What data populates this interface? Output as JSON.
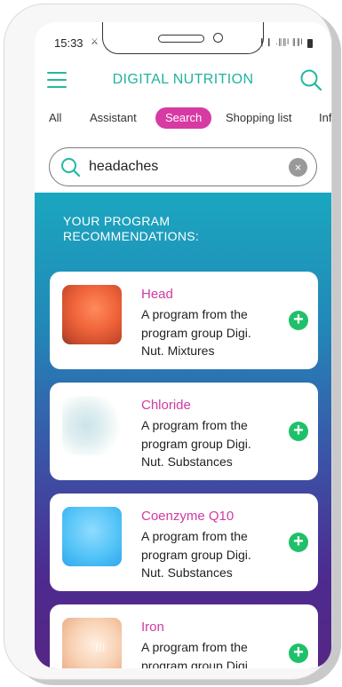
{
  "status_bar": {
    "time": "15:33",
    "signal_left": "⚔",
    "signal_right": "❙❙ .∥∥l ∥∥l"
  },
  "header": {
    "title": "DIGITAL NUTRITION"
  },
  "tabs": {
    "all": "All",
    "assistant": "Assistant",
    "search": "Search",
    "shopping_list": "Shopping list",
    "info": "Inf"
  },
  "search": {
    "value": "headaches",
    "clear": "×"
  },
  "results": {
    "heading": "YOUR PROGRAM RECOMMENDATIONS:",
    "cards": [
      {
        "title": "Head",
        "description": "A program from the program group Digi. Nut. Mixtures",
        "image": "head-image"
      },
      {
        "title": "Chloride",
        "description": "A program from the program group Digi. Nut. Substances",
        "image": "chloride-image"
      },
      {
        "title": "Coenzyme Q10",
        "description": "A program from the program group Digi. Nut. Substances",
        "image": "coenzyme-image"
      },
      {
        "title": "Iron",
        "description": "A program from the program group Digi.",
        "image": "iron-image"
      }
    ],
    "add": "+"
  },
  "nav": {
    "recents": "III",
    "home": "○",
    "back": "<"
  },
  "colors": {
    "accent_teal": "#20b39b",
    "accent_pink": "#d73aa3",
    "add_green": "#1fc06a"
  }
}
